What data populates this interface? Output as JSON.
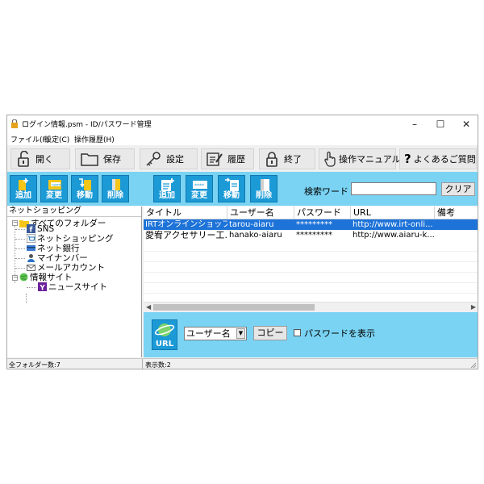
{
  "window": {
    "title": "ログイン情報.psm - ID/パスワード管理",
    "controls": {
      "minimize": "–",
      "maximize": "☐",
      "close": "✕"
    }
  },
  "menu": [
    "ファイル(F)",
    "設定(C)",
    "操作履歴(H)"
  ],
  "toolbar": {
    "open": "開く",
    "save": "保存",
    "settings": "設定",
    "history": "履歴",
    "exit": "終了",
    "manual": "操作マニュアル",
    "faq": "よくあるご質問"
  },
  "folder_tools": {
    "add": "追加",
    "edit": "変更",
    "move": "移動",
    "delete": "削除"
  },
  "item_tools": {
    "add": "追加",
    "edit": "変更",
    "move": "移動",
    "delete": "削除"
  },
  "search": {
    "label": "検索ワード",
    "value": "",
    "clear": "クリア"
  },
  "tree": {
    "header": "ネットショッピング",
    "root": "すべてのフォルダー",
    "children": [
      "SNS",
      "ネットショッピング",
      "ネット銀行",
      "マイナンバー",
      "メールアカウント",
      "情報サイト"
    ],
    "grandchild": "ニュースサイト"
  },
  "list": {
    "columns": [
      "タイトル",
      "ユーザー名",
      "パスワード",
      "URL",
      "備考"
    ],
    "rows": [
      {
        "title": "IRTオンラインショップ",
        "user": "tarou-aiaru",
        "password": "*********",
        "url": "http://www.irt-onli...",
        "note": ""
      },
      {
        "title": "愛宥アクセサリー工...",
        "user": "hanako-aiaru",
        "password": "*********",
        "url": "http://www.aiaru-k...",
        "note": ""
      }
    ]
  },
  "bottom": {
    "url_icon": "URL",
    "field": "ユーザー名",
    "copy": "コピー",
    "show_password": "パスワードを表示"
  },
  "status": {
    "folders": "全フォルダー数:7",
    "shown": "表示数:2"
  },
  "colors": {
    "accent": "#7ad3f3",
    "button": "#1b9ad6",
    "selection": "#1e73d8"
  }
}
